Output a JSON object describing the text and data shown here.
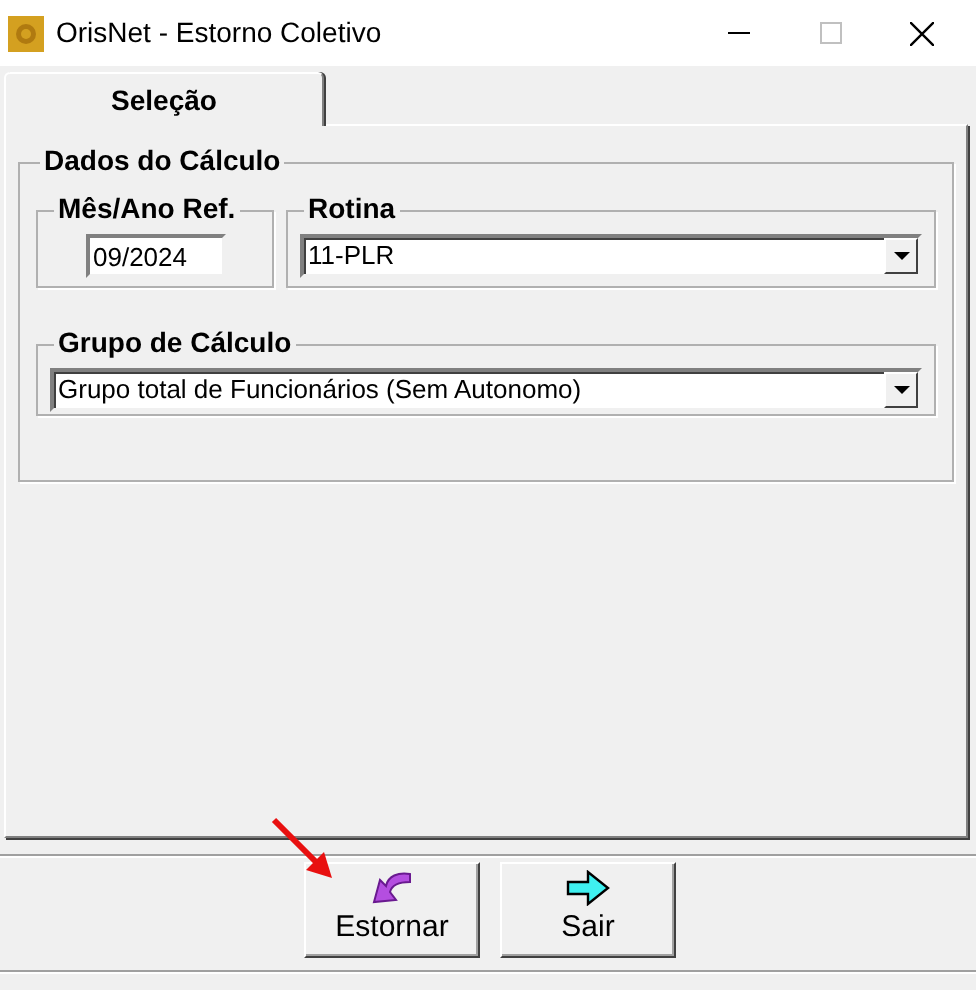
{
  "window": {
    "title": "OrisNet - Estorno Coletivo"
  },
  "tabs": [
    {
      "label": "Seleção",
      "selected": true
    }
  ],
  "group": {
    "title": "Dados do Cálculo",
    "period": {
      "label": "Mês/Ano Ref.",
      "value": "09/2024"
    },
    "routine": {
      "label": "Rotina",
      "value": "11-PLR"
    },
    "calc_group": {
      "label": "Grupo de Cálculo",
      "value": "Grupo total de Funcionários (Sem Autonomo)"
    }
  },
  "buttons": [
    {
      "label": "Estornar",
      "kind": "undo"
    },
    {
      "label": "Sair",
      "kind": "exit"
    }
  ]
}
